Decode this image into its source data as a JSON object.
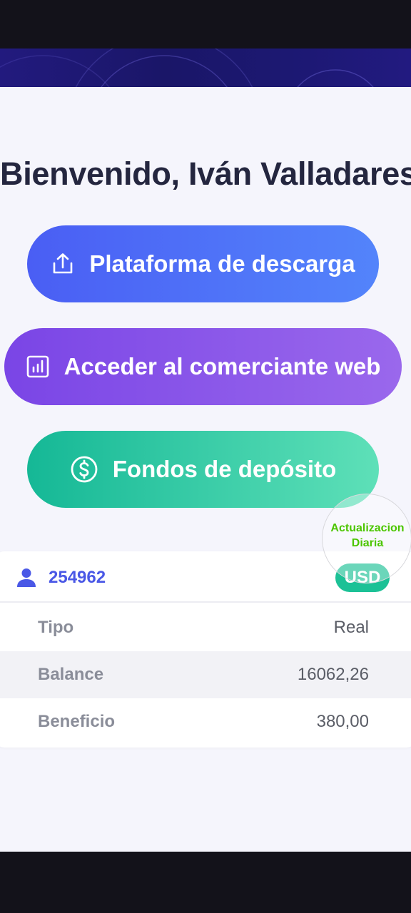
{
  "header": {
    "welcome_text": "Bienvenido, Iván Valladares"
  },
  "actions": {
    "download": {
      "label": "Plataforma de descarga",
      "icon": "upload-icon"
    },
    "web_trader": {
      "label": "Acceder al comerciante web",
      "icon": "chart-icon"
    },
    "deposit": {
      "label": "Fondos de depósito",
      "icon": "dollar-icon"
    }
  },
  "account": {
    "id": "254962",
    "currency": "USD",
    "rows": [
      {
        "label": "Tipo",
        "value": "Real"
      },
      {
        "label": "Balance",
        "value": "16062,26"
      },
      {
        "label": "Beneficio",
        "value": "380,00"
      }
    ]
  },
  "overlay": {
    "line1": "Actualizacion",
    "line2": "Diaria"
  },
  "colors": {
    "download_button": "#4a5ef4",
    "web_button": "#7a45e6",
    "deposit_button": "#15b896",
    "currency_badge": "#1cc196",
    "account_id": "#4a58e6",
    "overlay_text": "#4cc600"
  }
}
